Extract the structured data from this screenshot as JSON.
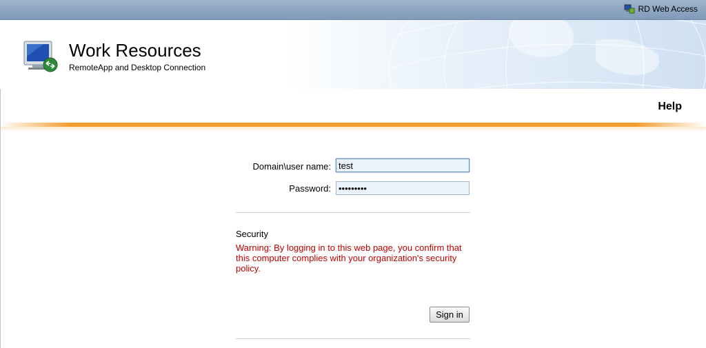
{
  "topbar": {
    "brand_label": "RD Web Access",
    "brand_icon": "rd-web-access-icon"
  },
  "header": {
    "title": "Work Resources",
    "subtitle": "RemoteApp and Desktop Connection",
    "logo_icon": "remote-desktop-monitor-icon"
  },
  "nav": {
    "help_label": "Help"
  },
  "login": {
    "username_label": "Domain\\user name:",
    "username_value": "test",
    "password_label": "Password:",
    "password_value": "testtestt",
    "security_title": "Security",
    "warning_text": "Warning: By logging in to this web page, you confirm that this computer complies with your organization's security policy.",
    "sign_in_label": "Sign in"
  },
  "colors": {
    "accent_orange": "#f39b2e",
    "warning_red": "#c00000",
    "topbar_blue": "#8ea7c3"
  }
}
